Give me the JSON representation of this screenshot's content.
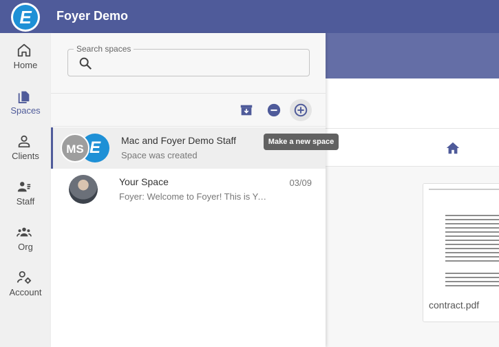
{
  "header": {
    "title": "Foyer Demo",
    "logo_letter": "E"
  },
  "rail": {
    "items": [
      {
        "label": "Home",
        "icon": "home-icon"
      },
      {
        "label": "Spaces",
        "icon": "spaces-icon",
        "active": true
      },
      {
        "label": "Clients",
        "icon": "clients-icon"
      },
      {
        "label": "Staff",
        "icon": "staff-icon"
      },
      {
        "label": "Org",
        "icon": "org-icon"
      },
      {
        "label": "Account",
        "icon": "account-icon"
      }
    ]
  },
  "search": {
    "label": "Search spaces",
    "value": "",
    "placeholder": ""
  },
  "toolbar": {
    "archive_icon": "archive-icon",
    "remove_icon": "remove-circle-icon",
    "add_icon": "add-circle-icon",
    "tooltip": "Make a new space"
  },
  "spaces": [
    {
      "title": "Mac and Foyer Demo Staff",
      "subtitle": "Space was created",
      "date": "",
      "avatar_initials": "MS",
      "avatar_letter": "E"
    },
    {
      "title": "Your Space",
      "subtitle": "Foyer: Welcome to Foyer! This is Your Space.",
      "date": "03/09"
    }
  ],
  "document": {
    "name": "contract.pdf"
  },
  "colors": {
    "primary": "#4f5b9a",
    "accent_blue": "#1e90d6",
    "tooltip_bg": "#616161"
  }
}
